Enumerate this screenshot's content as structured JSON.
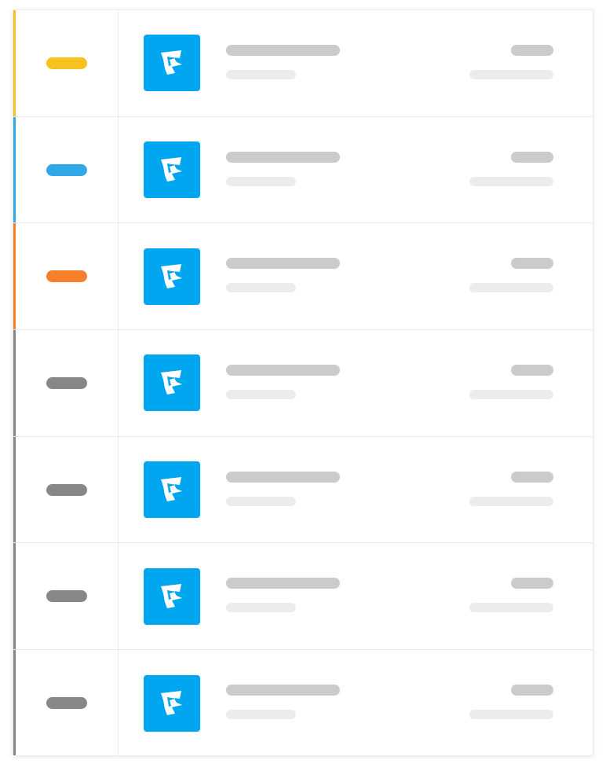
{
  "list": {
    "rows": [
      {
        "status_color": "#f7c21d",
        "accent_color": "#f7c21d",
        "icon": "app-logo-icon",
        "icon_bg": "#00a6f0"
      },
      {
        "status_color": "#2ea8e6",
        "accent_color": "#2ea8e6",
        "icon": "app-logo-icon",
        "icon_bg": "#00a6f0"
      },
      {
        "status_color": "#f57f2a",
        "accent_color": "#f57f2a",
        "icon": "app-logo-icon",
        "icon_bg": "#00a6f0"
      },
      {
        "status_color": "#878787",
        "accent_color": "#878787",
        "icon": "app-logo-icon",
        "icon_bg": "#00a6f0"
      },
      {
        "status_color": "#878787",
        "accent_color": "#878787",
        "icon": "app-logo-icon",
        "icon_bg": "#00a6f0"
      },
      {
        "status_color": "#878787",
        "accent_color": "#878787",
        "icon": "app-logo-icon",
        "icon_bg": "#00a6f0"
      },
      {
        "status_color": "#878787",
        "accent_color": "#878787",
        "icon": "app-logo-icon",
        "icon_bg": "#00a6f0"
      }
    ]
  }
}
